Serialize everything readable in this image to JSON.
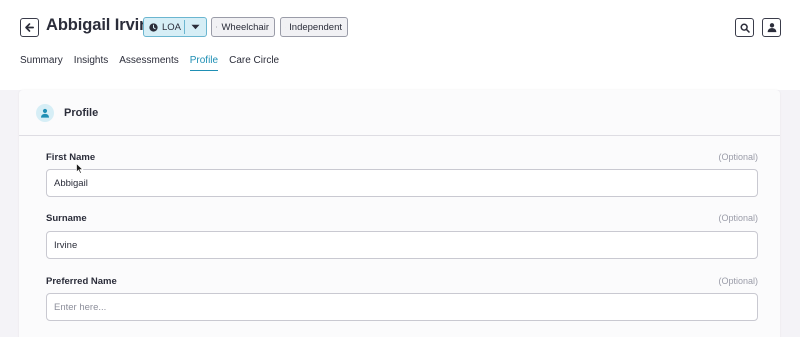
{
  "header": {
    "back_icon": "arrow-left-icon",
    "patient_name": "Abbigail Irvine",
    "status": {
      "label": "LOA",
      "icon": "clock-icon",
      "caret_icon": "caret-down-icon"
    },
    "tags": [
      {
        "label": "Wheelchair",
        "icon": "wheelchair-icon"
      },
      {
        "label": "Independent",
        "icon": "medical-bag-icon"
      }
    ],
    "search_icon": "search-icon",
    "user_icon": "user-icon"
  },
  "tabs": [
    {
      "label": "Summary",
      "active": false
    },
    {
      "label": "Insights",
      "active": false
    },
    {
      "label": "Assessments",
      "active": false
    },
    {
      "label": "Profile",
      "active": true
    },
    {
      "label": "Care Circle",
      "active": false
    }
  ],
  "card": {
    "title": "Profile",
    "icon": "person-icon",
    "fields": [
      {
        "label": "First Name",
        "optional": "(Optional)",
        "value": "Abbigail",
        "placeholder": ""
      },
      {
        "label": "Surname",
        "optional": "(Optional)",
        "value": "Irvine",
        "placeholder": ""
      },
      {
        "label": "Preferred Name",
        "optional": "(Optional)",
        "value": "",
        "placeholder": "Enter here..."
      }
    ]
  },
  "colors": {
    "accent": "#1f8fb4",
    "status_bg": "#d6eef6",
    "status_border": "#6bb6d0",
    "background": "#f4f3f7"
  }
}
